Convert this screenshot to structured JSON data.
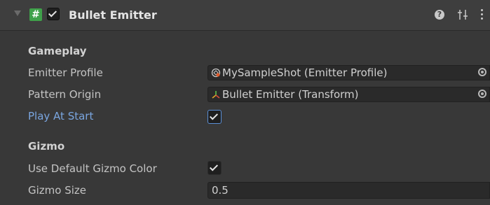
{
  "component": {
    "title": "Bullet Emitter",
    "script_icon_glyph": "#",
    "enabled": true,
    "icons": {
      "foldout": "foldout-triangle-icon",
      "script": "cs-script-icon",
      "help": "help-icon",
      "presets": "presets-icon",
      "menu": "kebab-menu-icon"
    },
    "help_glyph": "?"
  },
  "sections": {
    "gameplay": {
      "header": "Gameplay",
      "emitter_profile": {
        "label": "Emitter Profile",
        "value": "MySampleShot (Emitter Profile)",
        "icon": "scriptable-object-icon"
      },
      "pattern_origin": {
        "label": "Pattern Origin",
        "value": "Bullet Emitter (Transform)",
        "icon": "transform-icon"
      },
      "play_at_start": {
        "label": "Play At Start",
        "checked": true
      }
    },
    "gizmo": {
      "header": "Gizmo",
      "use_default_color": {
        "label": "Use Default Gizmo Color",
        "checked": true
      },
      "gizmo_size": {
        "label": "Gizmo Size",
        "value": "0.5"
      }
    }
  },
  "colors": {
    "background": "#383838",
    "header": "#3e3e3e",
    "field": "#2a2a2a",
    "modified_label": "#7aa6e0",
    "script_icon": "#3fa14a",
    "focus_border": "#5a8fd6"
  }
}
